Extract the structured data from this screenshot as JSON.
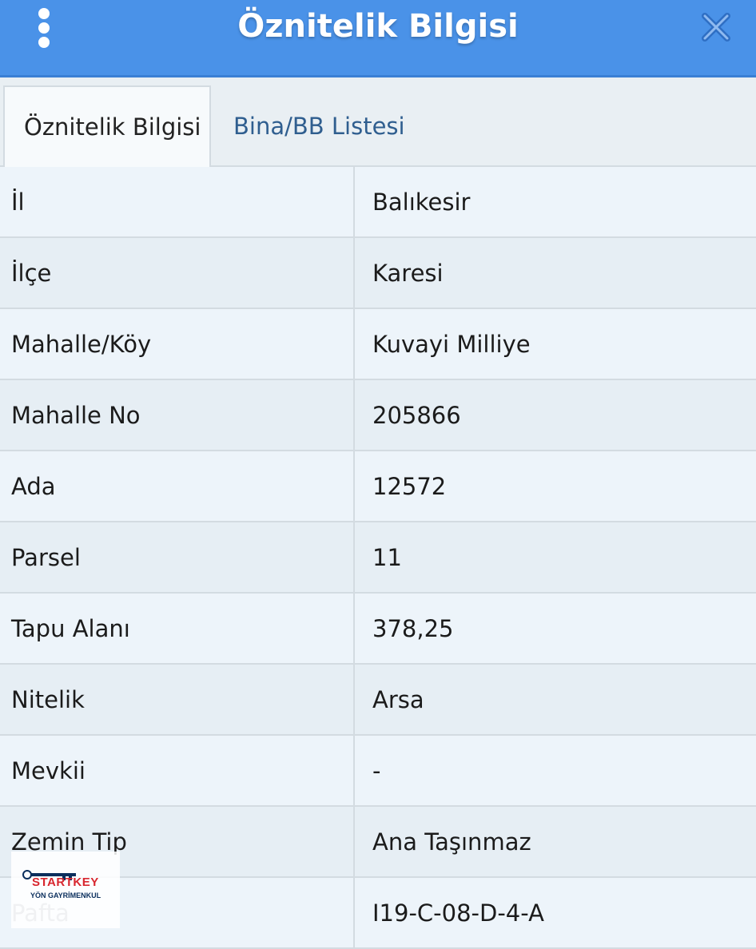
{
  "header": {
    "title": "Öznitelik Bilgisi",
    "menu_icon": "more-vertical-icon",
    "close_icon": "close-icon",
    "color": "#4a92e8"
  },
  "tabs": [
    {
      "label": "Öznitelik Bilgisi",
      "active": true
    },
    {
      "label": "Bina/BB Listesi",
      "active": false
    }
  ],
  "attributes": [
    {
      "key": "İl",
      "value": "Balıkesir"
    },
    {
      "key": "İlçe",
      "value": "Karesi"
    },
    {
      "key": "Mahalle/Köy",
      "value": "Kuvayi Milliye"
    },
    {
      "key": "Mahalle No",
      "value": "205866"
    },
    {
      "key": "Ada",
      "value": "12572"
    },
    {
      "key": "Parsel",
      "value": "11"
    },
    {
      "key": "Tapu Alanı",
      "value": "378,25"
    },
    {
      "key": "Nitelik",
      "value": "Arsa"
    },
    {
      "key": "Mevkii",
      "value": "-"
    },
    {
      "key": "Zemin Tip",
      "value": "Ana Taşınmaz"
    },
    {
      "key": "Pafta",
      "value": "I19-C-08-D-4-A"
    }
  ],
  "logo": {
    "brand": "STARTKEY",
    "subtitle": "YÖN GAYRİMENKUL",
    "color": "#d8262e"
  }
}
